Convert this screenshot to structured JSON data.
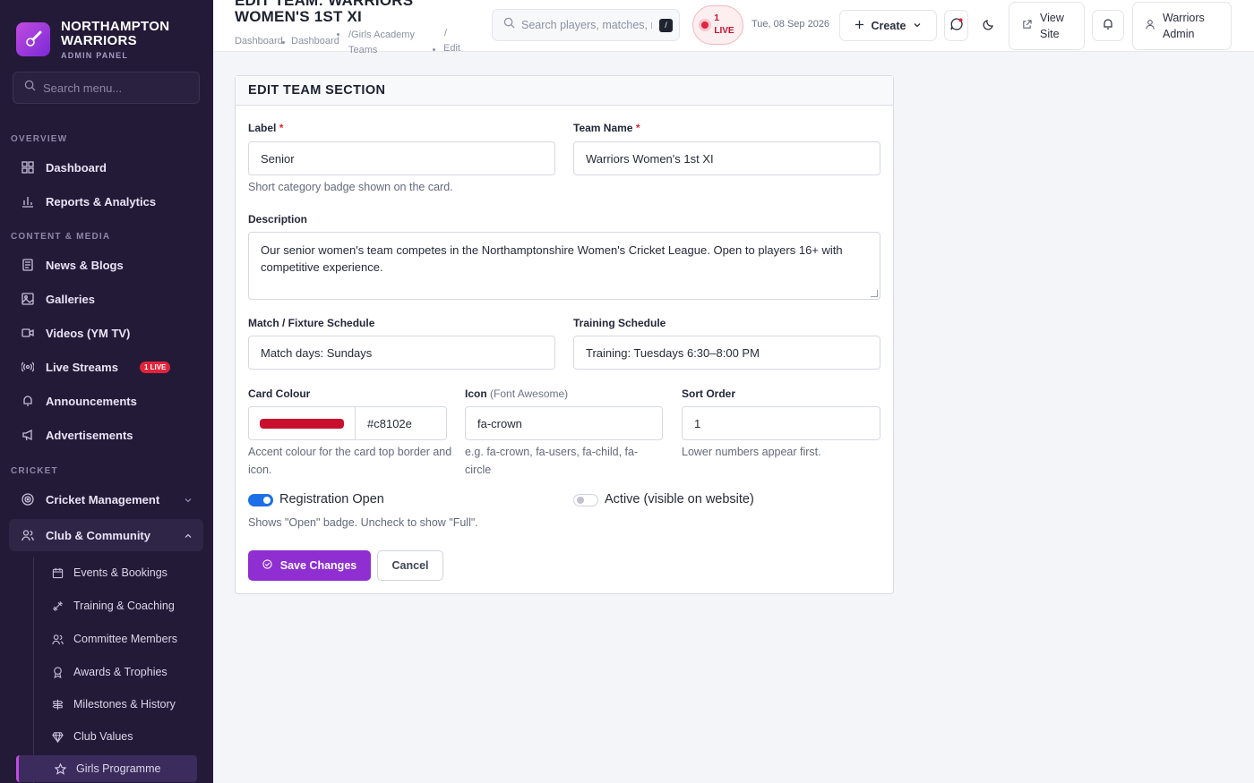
{
  "brand": {
    "name": "NORTHAMPTON WARRIORS",
    "subtitle": "ADMIN PANEL",
    "logo_icon": "cricket-logo-icon"
  },
  "sidebar": {
    "search_placeholder": "Search menu...",
    "sections": {
      "overview": "OVERVIEW",
      "content": "CONTENT & MEDIA",
      "cricket": "CRICKET"
    },
    "items": {
      "dashboard": "Dashboard",
      "reports": "Reports & Analytics",
      "news": "News & Blogs",
      "galleries": "Galleries",
      "videos": "Videos (YM TV)",
      "streams": "Live Streams",
      "streams_badge": "1 LIVE",
      "announcements": "Announcements",
      "ads": "Advertisements",
      "cricket_mgmt": "Cricket Management",
      "club": "Club & Community"
    },
    "subitems": {
      "events": "Events & Bookings",
      "training": "Training & Coaching",
      "committee": "Committee Members",
      "awards": "Awards & Trophies",
      "milestones": "Milestones & History",
      "values": "Club Values",
      "girls": "Girls Programme"
    }
  },
  "header": {
    "title": "EDIT TEAM: WARRIORS WOMEN'S 1ST XI",
    "breadcrumb": [
      "Dashboard",
      "Dashboard",
      "/Girls Academy Teams",
      "/",
      "Edit"
    ],
    "search_placeholder": "Search players, matches, r",
    "search_kbd": "/",
    "live_count": "1",
    "live_label": "LIVE",
    "date": "Tue, 08 Sep 2026",
    "create_label": "Create",
    "view_site_label": "View Site",
    "user_name": "Warriors Admin"
  },
  "form": {
    "heading": "EDIT TEAM SECTION",
    "label_field": {
      "label": "Label",
      "required": "*",
      "value": "Senior",
      "help": "Short category badge shown on the card."
    },
    "team_name": {
      "label": "Team Name",
      "required": "*",
      "value": "Warriors Women's 1st XI"
    },
    "description": {
      "label": "Description",
      "value": "Our senior women's team competes in the Northamptonshire Women's Cricket League. Open to players 16+ with competitive experience."
    },
    "match_schedule": {
      "label": "Match / Fixture Schedule",
      "value": "Match days: Sundays"
    },
    "training_schedule": {
      "label": "Training Schedule",
      "value": "Training: Tuesdays 6:30–8:00 PM"
    },
    "card_colour": {
      "label": "Card Colour",
      "value": "#c8102e",
      "swatch": "#c8102e",
      "help": "Accent colour for the card top border and icon."
    },
    "icon": {
      "label": "Icon",
      "label_note": "(Font Awesome)",
      "value": "fa-crown",
      "help": "e.g. fa-crown, fa-users, fa-child, fa-circle"
    },
    "sort_order": {
      "label": "Sort Order",
      "value": "1",
      "help": "Lower numbers appear first."
    },
    "registration": {
      "label": "Registration Open",
      "checked": true,
      "help": "Shows \"Open\" badge. Uncheck to show \"Full\"."
    },
    "active": {
      "label": "Active (visible on website)",
      "checked": false
    },
    "save_label": "Save Changes",
    "cancel_label": "Cancel"
  },
  "colors": {
    "accent": "#8f2ed1",
    "sidebar_bg": "#231a38",
    "live": "#e0243b",
    "toggle_on": "#1d6fe8"
  }
}
